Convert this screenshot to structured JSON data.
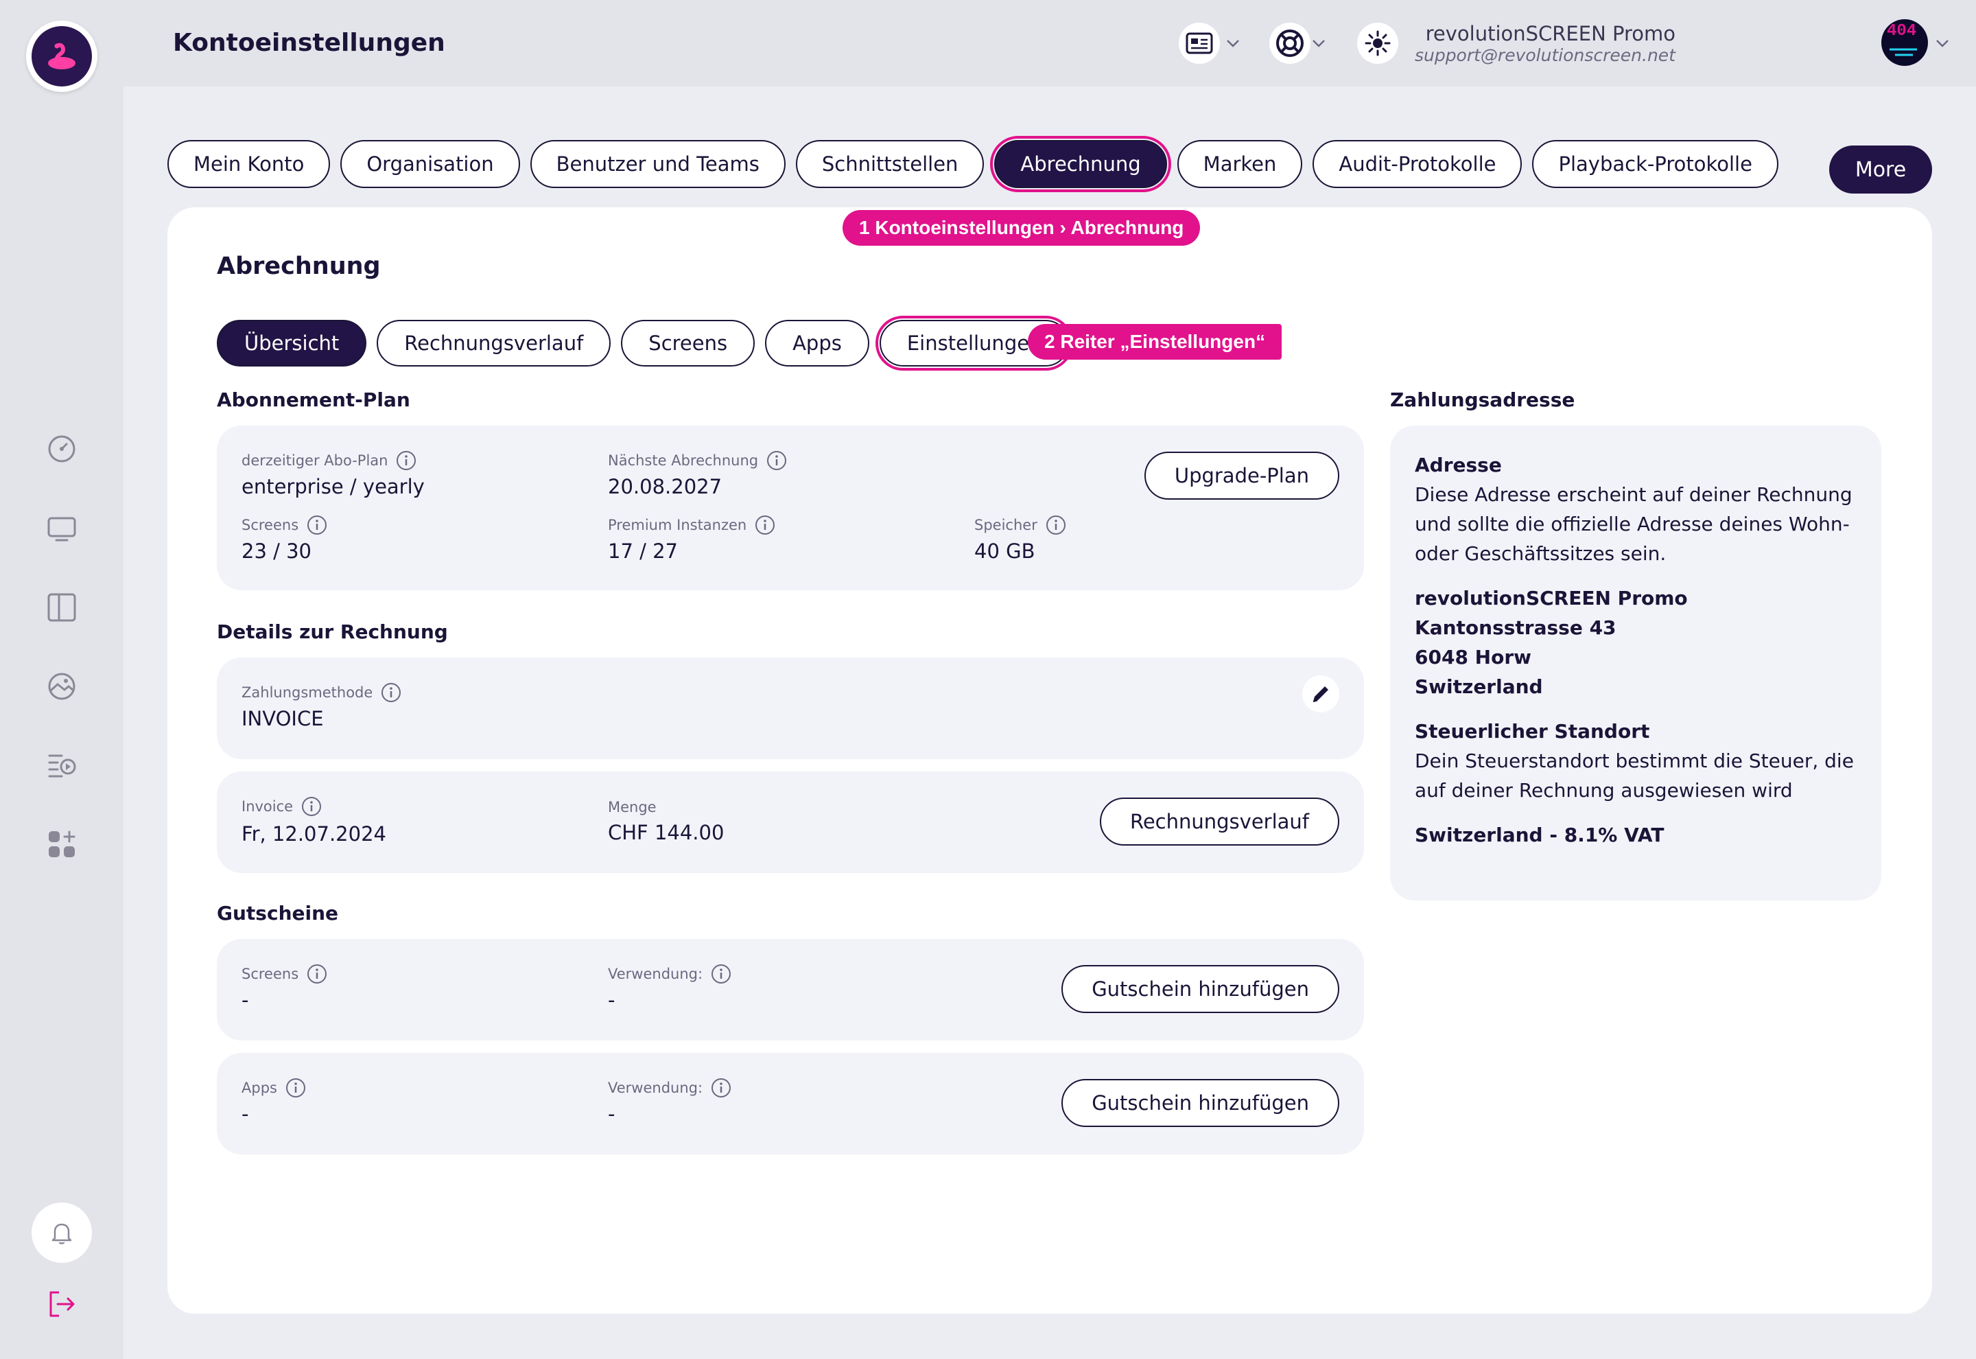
{
  "header": {
    "title": "Kontoeinstellungen",
    "org_name": "revolutionSCREEN Promo",
    "org_email": "support@revolutionscreen.net",
    "avatar_text": "404"
  },
  "top_tabs": [
    {
      "label": "Mein Konto",
      "active": false
    },
    {
      "label": "Organisation",
      "active": false
    },
    {
      "label": "Benutzer und Teams",
      "active": false
    },
    {
      "label": "Schnittstellen",
      "active": false
    },
    {
      "label": "Abrechnung",
      "active": true
    },
    {
      "label": "Marken",
      "active": false
    },
    {
      "label": "Audit-Protokolle",
      "active": false
    },
    {
      "label": "Playback-Protokolle",
      "active": false
    }
  ],
  "more_label": "More",
  "callouts": {
    "one": "1  Kontoeinstellungen › Abrechnung",
    "two": "2  Reiter „Einstellungen“"
  },
  "card": {
    "title": "Abrechnung",
    "sub_tabs": [
      {
        "label": "Übersicht",
        "selected": true
      },
      {
        "label": "Rechnungsverlauf",
        "selected": false
      },
      {
        "label": "Screens",
        "selected": false
      },
      {
        "label": "Apps",
        "selected": false
      },
      {
        "label": "Einstellungen",
        "selected": false
      }
    ]
  },
  "plan": {
    "section_title": "Abonnement-Plan",
    "current_plan_label": "derzeitiger Abo-Plan",
    "current_plan_value": "enterprise / yearly",
    "next_billing_label": "Nächste Abrechnung",
    "next_billing_value": "20.08.2027",
    "upgrade_label": "Upgrade-Plan",
    "screens_label": "Screens",
    "screens_value": "23 / 30",
    "premium_label": "Premium Instanzen",
    "premium_value": "17 / 27",
    "storage_label": "Speicher",
    "storage_value": "40 GB"
  },
  "invoice_details": {
    "section_title": "Details zur Rechnung",
    "payment_method_label": "Zahlungsmethode",
    "payment_method_value": "INVOICE",
    "invoice_label": "Invoice",
    "invoice_value": "Fr, 12.07.2024",
    "amount_label": "Menge",
    "amount_value": "CHF 144.00",
    "history_button": "Rechnungsverlauf"
  },
  "vouchers": {
    "section_title": "Gutscheine",
    "rows": [
      {
        "label": "Screens",
        "value": "-",
        "usage_label": "Verwendung:",
        "usage_value": "-",
        "button": "Gutschein hinzufügen"
      },
      {
        "label": "Apps",
        "value": "-",
        "usage_label": "Verwendung:",
        "usage_value": "-",
        "button": "Gutschein hinzufügen"
      }
    ]
  },
  "address": {
    "section_title": "Zahlungsadresse",
    "heading": "Adresse",
    "description": "Diese Adresse erscheint auf deiner Rechnung und sollte die offizielle Adresse deines Wohn- oder Geschäftssitzes sein.",
    "lines": [
      "revolutionSCREEN Promo",
      "Kantonsstrasse 43",
      "6048 Horw",
      "Switzerland"
    ],
    "tax_heading": "Steuerlicher Standort",
    "tax_description": "Dein Steuerstandort bestimmt die Steuer, die auf deiner Rechnung ausgewiesen wird",
    "tax_value": "Switzerland - 8.1% VAT"
  },
  "colors": {
    "primary": "#221446",
    "accent": "#e1128c",
    "background": "#ecedf2",
    "panel": "#f2f3f8"
  },
  "icons": {
    "sidebar": [
      "dashboard-icon",
      "screen-icon",
      "layout-icon",
      "media-icon",
      "playlist-icon",
      "apps-icon"
    ],
    "bottom": [
      "bell-icon",
      "logout-icon"
    ]
  }
}
